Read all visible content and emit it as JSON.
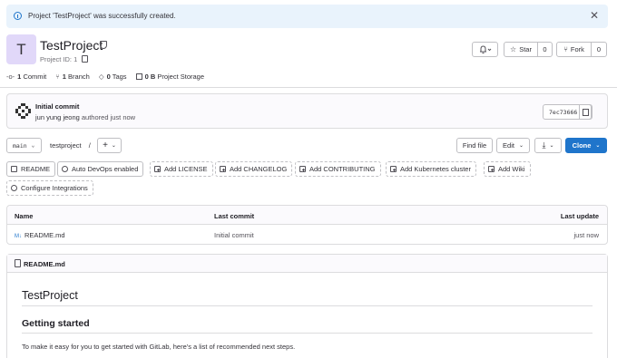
{
  "alert": {
    "message": "Project 'TestProject' was successfully created."
  },
  "project": {
    "avatar_letter": "T",
    "name": "TestProject",
    "id_label": "Project ID: 1"
  },
  "actions": {
    "star_label": "Star",
    "star_count": "0",
    "fork_label": "Fork",
    "fork_count": "0"
  },
  "stats": {
    "commits_num": "1",
    "commits_label": "Commit",
    "branches_num": "1",
    "branches_label": "Branch",
    "tags_num": "0",
    "tags_label": "Tags",
    "storage_num": "0 B",
    "storage_label": "Project Storage"
  },
  "last_commit": {
    "title": "Initial commit",
    "author": "jun yung jeong",
    "meta": " authored just now",
    "sha": "7ec73666"
  },
  "toolbar": {
    "branch": "main",
    "path": "testproject",
    "path_sep": "/",
    "add": "+",
    "find_file": "Find file",
    "edit": "Edit",
    "clone": "Clone"
  },
  "suggestions": [
    "README",
    "Auto DevOps enabled",
    "Add LICENSE",
    "Add CHANGELOG",
    "Add CONTRIBUTING",
    "Add Kubernetes cluster",
    "Add Wiki",
    "Configure Integrations"
  ],
  "files": {
    "headers": {
      "name": "Name",
      "last_commit": "Last commit",
      "last_update": "Last update"
    },
    "rows": [
      {
        "name": "README.md",
        "commit": "Initial commit",
        "updated": "just now"
      }
    ]
  },
  "readme": {
    "filename": "README.md",
    "h1": "TestProject",
    "h2": "Getting started",
    "para": "To make it easy for you to get started with GitLab, here's a list of recommended next steps."
  },
  "colors": {
    "primary": "#1f75cb",
    "info_bg": "#e9f3fc",
    "avatar_bg": "#e1d8f9"
  }
}
